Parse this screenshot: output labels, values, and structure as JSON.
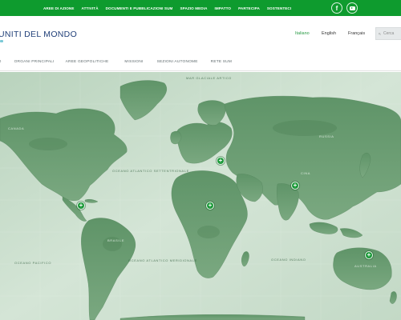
{
  "topbar": {
    "links": [
      "Aree di azione",
      "Attività",
      "Documenti e Pubblicazioni SUM",
      "Spazio media",
      "Impatto",
      "Partecipa",
      "Sostenteci"
    ],
    "facebook_glyph": "f",
    "facebook_icon": "facebook-icon",
    "youtube_icon": "youtube-icon"
  },
  "header": {
    "site_title": "UNITI DEL MONDO",
    "languages": [
      "Italiano",
      "English",
      "Français"
    ],
    "active_language": "Italiano",
    "search_placeholder": "Cerca",
    "search_icon": "search-icon"
  },
  "subnav": {
    "items": [
      "RO",
      "Organi principali",
      "Aree geopolitiche",
      "Missioni",
      "Sezioni autonome",
      "Rete SUM"
    ]
  },
  "map": {
    "labels": [
      "Oceano Atlantico Settentrionale",
      "Oceano Pacifico",
      "Oceano Atlantico Meridionale",
      "Oceano Indiano",
      "Brasile",
      "Russia",
      "Australia",
      "Canada",
      "Cina",
      "Mar Glaciale Artico"
    ],
    "pin_glyph": "+",
    "pin_icon": "plus-icon"
  },
  "colors": {
    "brand_green": "#0e9b2e",
    "title_blue": "#1f3e78",
    "active_language": "#2a9b45",
    "ocean": "#cfe0d1",
    "land": "#6f9e76",
    "pin": "#1d9a3a"
  }
}
